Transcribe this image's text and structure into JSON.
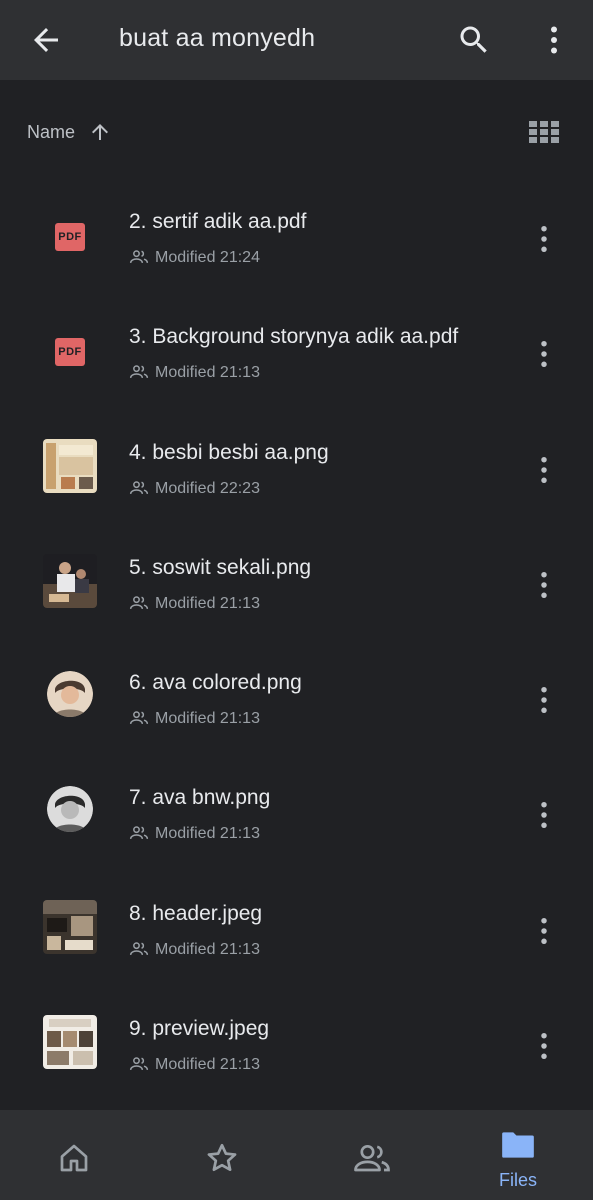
{
  "appbar": {
    "title": "buat aa monyedh",
    "back_icon": "arrow-back-icon",
    "search_icon": "search-icon",
    "more_icon": "more-vert-icon"
  },
  "sort": {
    "label": "Name",
    "direction_icon": "arrow-up-icon",
    "view_icon": "grid-view-icon"
  },
  "files": [
    {
      "name": "2. sertif adik aa.pdf",
      "modified": "Modified 21:24",
      "type": "pdf",
      "pdf_badge": "PDF"
    },
    {
      "name": "3. Background storynya adik aa.pdf",
      "modified": "Modified 21:13",
      "type": "pdf",
      "pdf_badge": "PDF"
    },
    {
      "name": "4. besbi besbi aa.png",
      "modified": "Modified 22:23",
      "type": "image"
    },
    {
      "name": "5. soswit sekali.png",
      "modified": "Modified 21:13",
      "type": "image"
    },
    {
      "name": "6. ava colored.png",
      "modified": "Modified 21:13",
      "type": "avatar"
    },
    {
      "name": "7. ava bnw.png",
      "modified": "Modified 21:13",
      "type": "avatar"
    },
    {
      "name": "8. header.jpeg",
      "modified": "Modified 21:13",
      "type": "image"
    },
    {
      "name": "9. preview.jpeg",
      "modified": "Modified 21:13",
      "type": "image"
    }
  ],
  "bottomnav": {
    "items": [
      {
        "icon": "home-icon",
        "label": ""
      },
      {
        "icon": "star-icon",
        "label": ""
      },
      {
        "icon": "shared-icon",
        "label": ""
      },
      {
        "icon": "folder-icon",
        "label": "Files",
        "active": true
      }
    ]
  },
  "colors": {
    "background": "#202124",
    "bar": "#2f3033",
    "accent": "#8ab4f8",
    "pdf_red": "#e06666"
  }
}
